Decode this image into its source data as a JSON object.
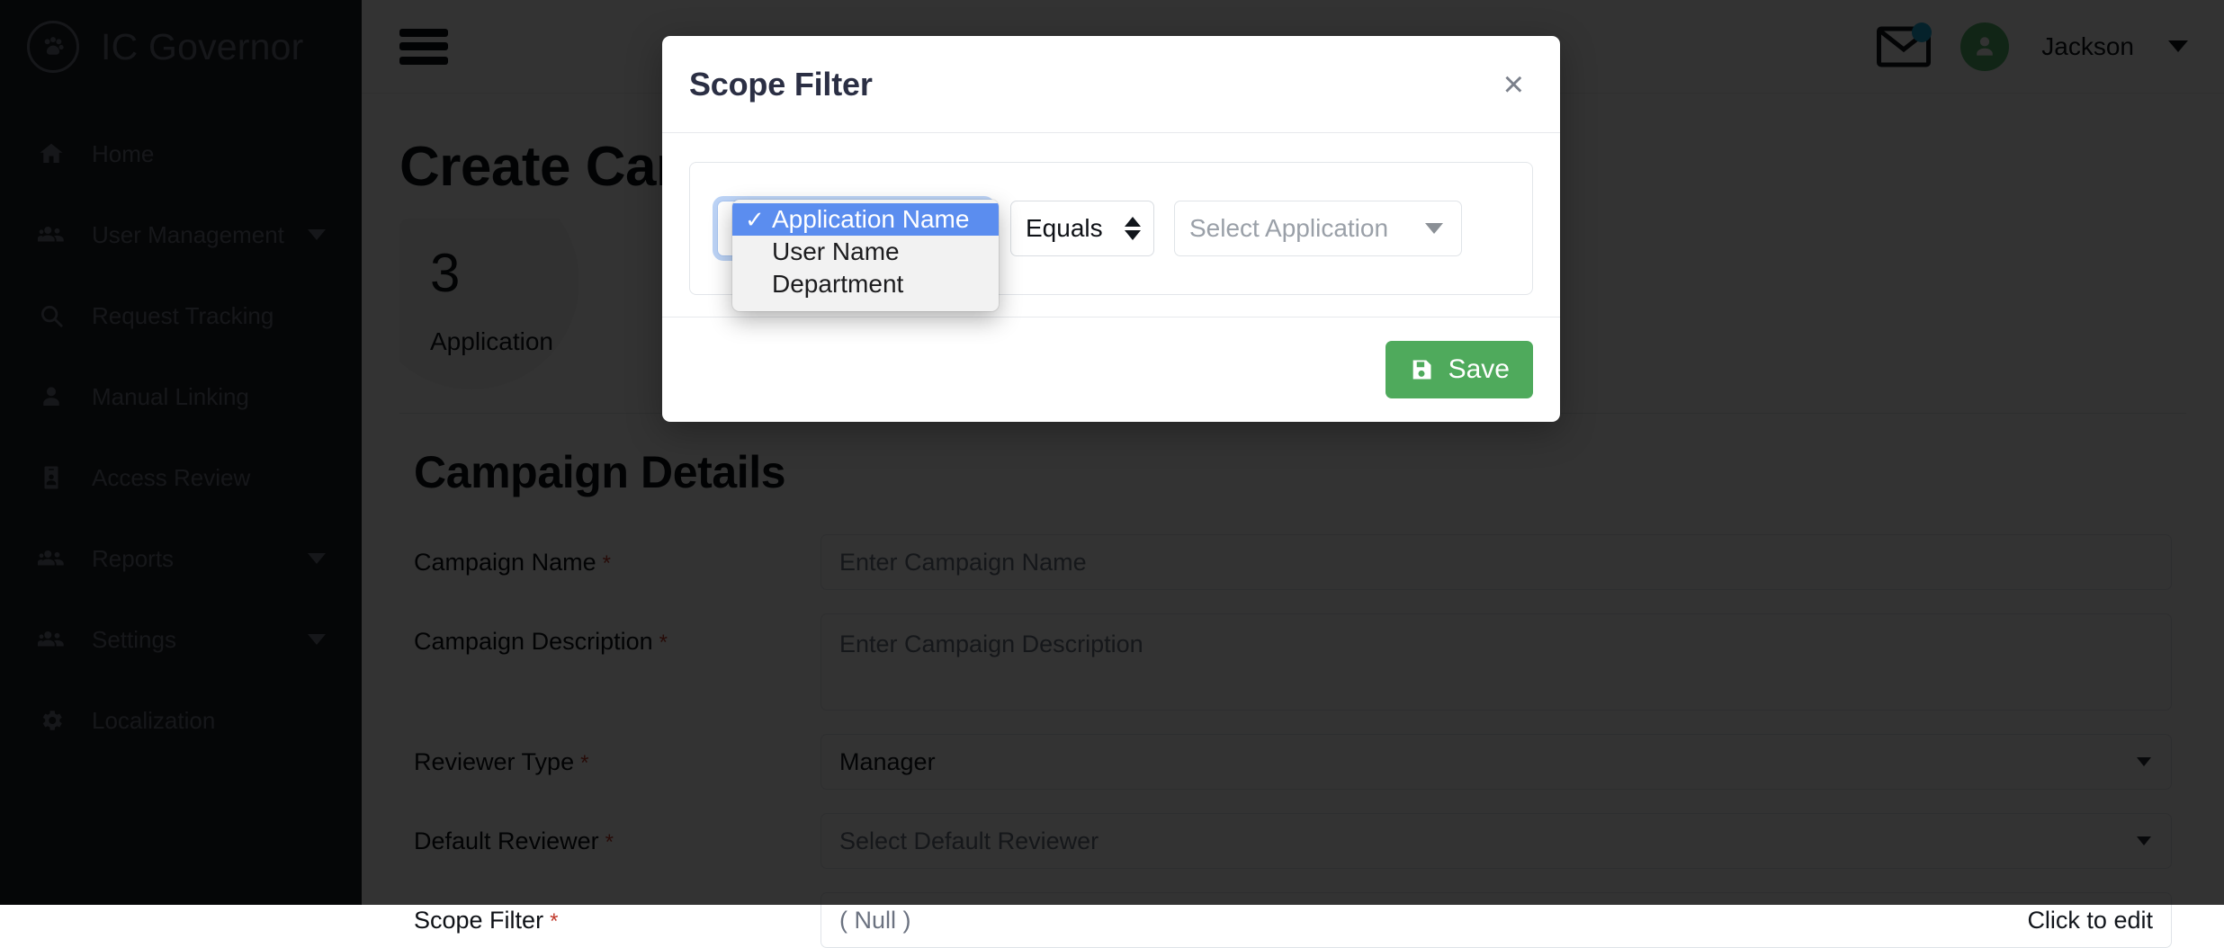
{
  "brand": {
    "title": "IC Governor",
    "logo_icon": "paw-circle-icon"
  },
  "sidebar": {
    "items": [
      {
        "label": "Home",
        "icon": "home-icon",
        "has_caret": false
      },
      {
        "label": "User Management",
        "icon": "users-icon",
        "has_caret": true
      },
      {
        "label": "Request Tracking",
        "icon": "search-icon",
        "has_caret": false
      },
      {
        "label": "Manual Linking",
        "icon": "user-icon",
        "has_caret": false
      },
      {
        "label": "Access Review",
        "icon": "id-badge-icon",
        "has_caret": false
      },
      {
        "label": "Reports",
        "icon": "users-icon",
        "has_caret": true
      },
      {
        "label": "Settings",
        "icon": "users-icon",
        "has_caret": true
      },
      {
        "label": "Localization",
        "icon": "gear-icon",
        "has_caret": false
      }
    ]
  },
  "topbar": {
    "menu_icon": "hamburger-icon",
    "mail_icon": "envelope-icon",
    "mail_badge_color": "#1ba9d6",
    "avatar_icon": "user-avatar-icon",
    "avatar_color": "#57bb6e",
    "user_name": "Jackson",
    "user_caret_icon": "chevron-down-icon"
  },
  "page": {
    "title": "Create Campaign",
    "stats": [
      {
        "value": "3",
        "label": "Application"
      }
    ],
    "panel_title": "Campaign Details"
  },
  "form": {
    "fields": [
      {
        "label": "Campaign Name",
        "required": true,
        "value": "Enter Campaign Name",
        "filled": false,
        "type": "text"
      },
      {
        "label": "Campaign Description",
        "required": true,
        "value": "Enter Campaign Description",
        "filled": false,
        "type": "textarea"
      },
      {
        "label": "Reviewer Type",
        "required": true,
        "value": "Manager",
        "filled": true,
        "type": "select"
      },
      {
        "label": "Default Reviewer",
        "required": true,
        "value": "Select Default Reviewer",
        "filled": false,
        "type": "select"
      }
    ],
    "scope_filter": {
      "label": "Scope Filter",
      "required": true,
      "value": "( Null )",
      "action_label": "Click to edit"
    }
  },
  "modal": {
    "title": "Scope Filter",
    "close_label": "×",
    "filter": {
      "attribute_selected": "Application Name",
      "attribute_options": [
        "Application Name",
        "User Name",
        "Department"
      ],
      "checkmark": "✓",
      "operator_selected": "Equals",
      "value_placeholder": "Select Application"
    },
    "save_label": "Save",
    "save_icon": "floppy-disk-icon",
    "save_color": "#4faa5c",
    "highlight_color": "#5b8def"
  }
}
